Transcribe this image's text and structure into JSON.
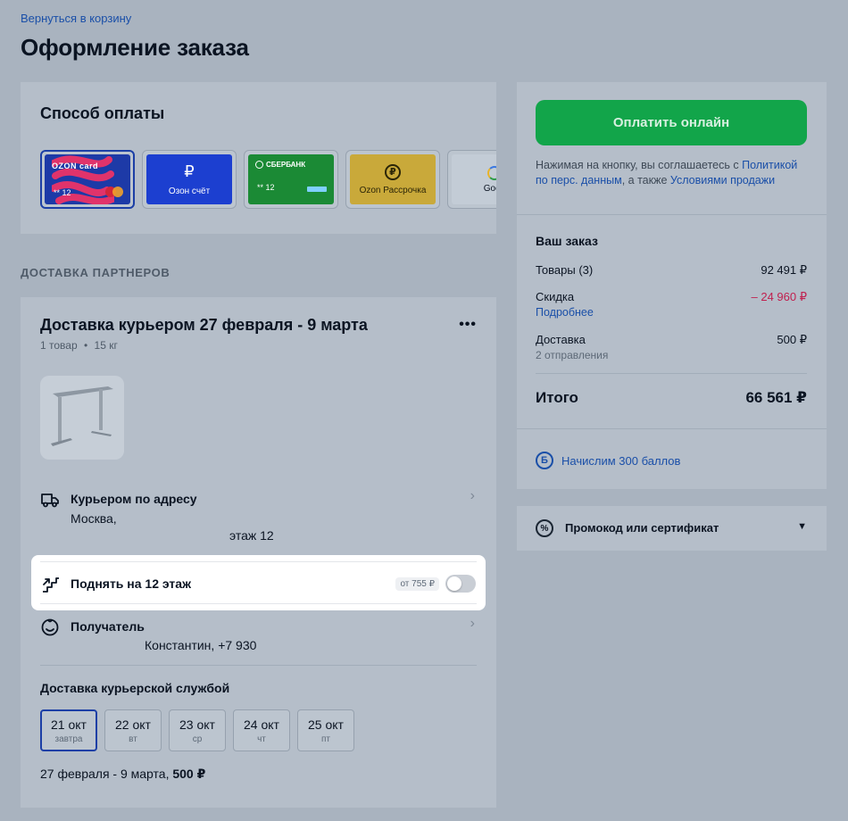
{
  "nav": {
    "back_link": "Вернуться в корзину"
  },
  "page": {
    "title": "Оформление заказа"
  },
  "payment": {
    "title": "Способ оплаты",
    "methods": [
      {
        "brand": "OZON card",
        "number": "** 12",
        "selected": true
      },
      {
        "label": "Озон счёт",
        "symbol": "₽"
      },
      {
        "brand": "СБЕРБАНК",
        "number": "** 12"
      },
      {
        "label": "Ozon Рассрочка",
        "symbol": "₽"
      },
      {
        "label": "Goog",
        "symbol": "G"
      }
    ]
  },
  "section_label": "ДОСТАВКА ПАРТНЕРОВ",
  "delivery": {
    "title": "Доставка курьером 27 февраля - 9 марта",
    "meta_items": "1 товар",
    "meta_weight": "15 кг",
    "meta_sep": "•",
    "address": {
      "title": "Курьером по адресу",
      "city": "Москва,",
      "floor": "этаж 12"
    },
    "lift": {
      "title": "Поднять на 12 этаж",
      "price": "от 755 ₽",
      "enabled": false
    },
    "recipient": {
      "title": "Получатель",
      "value": "Константин, +7 930"
    },
    "date_heading": "Доставка курьерской службой",
    "dates": [
      {
        "date": "21 окт",
        "weekday": "завтра",
        "selected": true
      },
      {
        "date": "22 окт",
        "weekday": "вт"
      },
      {
        "date": "23 окт",
        "weekday": "ср"
      },
      {
        "date": "24 окт",
        "weekday": "чт"
      },
      {
        "date": "25 окт",
        "weekday": "пт"
      }
    ],
    "summary_range": "27 февраля - 9 марта,",
    "summary_price": "500 ₽",
    "more_icon": "more-dots-icon"
  },
  "order": {
    "pay_button": "Оплатить онлайн",
    "consent_1": "Нажимая на кнопку, вы соглашаетесь с",
    "consent_link_1": "Политикой по перс. данным",
    "consent_2": ", а также",
    "consent_link_2": "Условиями продажи",
    "title": "Ваш заказ",
    "goods_label": "Товары (3)",
    "goods_value": "92 491 ₽",
    "discount_label": "Скидка",
    "discount_link": "Подробнее",
    "discount_value": "– 24 960 ₽",
    "delivery_label": "Доставка",
    "delivery_sub": "2 отправления",
    "delivery_value": "500 ₽",
    "total_label": "Итого",
    "total_value": "66 561 ₽",
    "bonus_icon_text": "Б",
    "bonus_text": "Начислим 300 баллов"
  },
  "promo": {
    "label": "Промокод или сертификат",
    "icon_text": "%"
  },
  "colors": {
    "accent": "#1a4fa8",
    "pay_button": "#12a54a",
    "discount": "#c0204f"
  }
}
